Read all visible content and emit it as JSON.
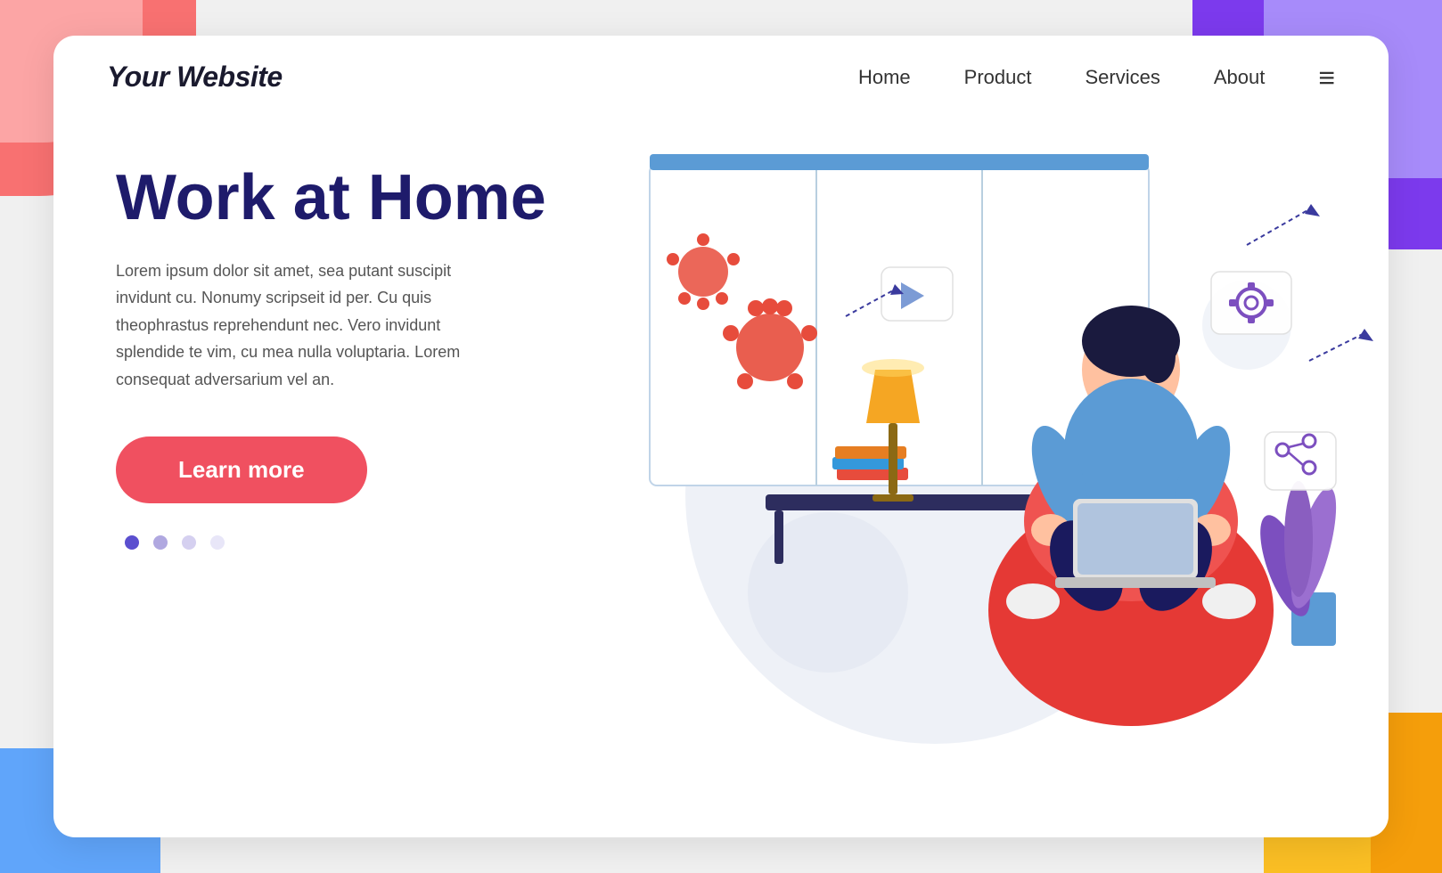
{
  "brand": {
    "logo": "Your Website"
  },
  "navbar": {
    "links": [
      {
        "label": "Home",
        "key": "home"
      },
      {
        "label": "Product",
        "key": "product"
      },
      {
        "label": "Services",
        "key": "services"
      },
      {
        "label": "About",
        "key": "about"
      }
    ],
    "menu_icon": "≡"
  },
  "hero": {
    "title": "Work at Home",
    "description": "Lorem ipsum dolor sit amet, sea putant suscipit invidunt cu. Nonumy scripseit id per. Cu quis theophrastus reprehendunt nec. Vero invidunt splendide te vim, cu mea nulla voluptaria. Lorem consequat adversarium vel an.",
    "cta_button": "Learn more"
  },
  "dots": [
    {
      "color": "#5b4fcf"
    },
    {
      "color": "#b0a8e0"
    },
    {
      "color": "#d5d0f0"
    },
    {
      "color": "#e8e6f8"
    }
  ],
  "colors": {
    "accent_red": "#f05060",
    "accent_purple": "#7c3aed",
    "accent_blue": "#60a5fa",
    "accent_orange": "#f59e0b",
    "title_dark": "#1e1b6b"
  }
}
